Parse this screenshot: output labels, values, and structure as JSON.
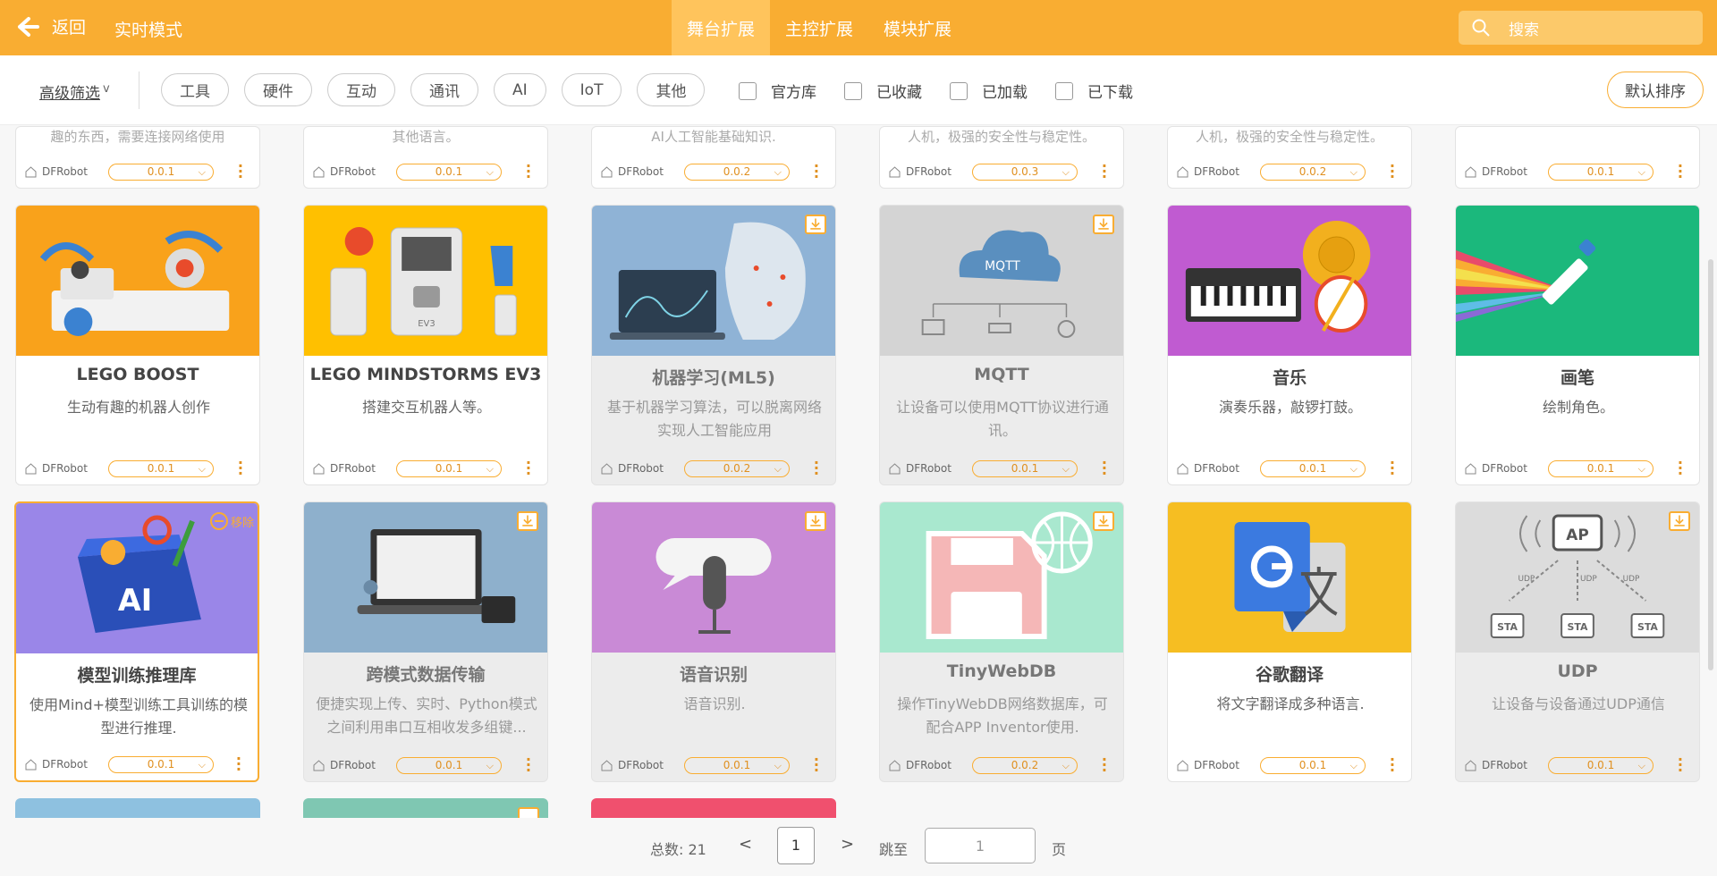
{
  "topbar": {
    "back_label": "返回",
    "realtime_label": "实时模式",
    "tabs": [
      "舞台扩展",
      "主控扩展",
      "模块扩展"
    ],
    "active_tab": 0,
    "search_placeholder": "搜索"
  },
  "filters": {
    "advanced_label": "高级筛选",
    "advanced_caret": "v",
    "chips": [
      "工具",
      "硬件",
      "互动",
      "通讯",
      "AI",
      "IoT",
      "其他"
    ],
    "checkboxes": [
      "官方库",
      "已收藏",
      "已加载",
      "已下载"
    ],
    "sort_label": "默认排序"
  },
  "top_partial_row": [
    {
      "desc": "趣的东西，需要连接网络使用",
      "author": "DFRobot",
      "version": "0.0.1"
    },
    {
      "desc": "其他语言。",
      "author": "DFRobot",
      "version": "0.0.1"
    },
    {
      "desc": "AI人工智能基础知识.",
      "author": "DFRobot",
      "version": "0.0.2"
    },
    {
      "desc": "人机，极强的安全性与稳定性。",
      "author": "DFRobot",
      "version": "0.0.3"
    },
    {
      "desc": "人机，极强的安全性与稳定性。",
      "author": "DFRobot",
      "version": "0.0.2"
    },
    {
      "desc": "",
      "author": "DFRobot",
      "version": "0.0.1"
    }
  ],
  "cards_row1": [
    {
      "title": "LEGO BOOST",
      "desc": "生动有趣的机器人创作",
      "author": "DFRobot",
      "version": "0.0.1",
      "image": "lego-boost-robot"
    },
    {
      "title": "LEGO MINDSTORMS EV3",
      "desc": "搭建交互机器人等。",
      "author": "DFRobot",
      "version": "0.0.1",
      "image": "lego-ev3-brick"
    },
    {
      "title": "机器学习(ML5)",
      "desc": "基于机器学习算法，可以脱离网络实现人工智能应用",
      "author": "DFRobot",
      "version": "0.0.2",
      "image": "ml5-face-laptop"
    },
    {
      "title": "MQTT",
      "desc": "让设备可以使用MQTT协议进行通讯。",
      "author": "DFRobot",
      "version": "0.0.1",
      "image": "mqtt-cloud"
    },
    {
      "title": "音乐",
      "desc": "演奏乐器，敲锣打鼓。",
      "author": "DFRobot",
      "version": "0.0.1",
      "image": "music-keyboard-drum"
    },
    {
      "title": "画笔",
      "desc": "绘制角色。",
      "author": "DFRobot",
      "version": "0.0.1",
      "image": "pen-rainbow"
    }
  ],
  "cards_row2": [
    {
      "title": "模型训练推理库",
      "desc": "使用Mind+模型训练工具训练的模型进行推理.",
      "author": "DFRobot",
      "version": "0.0.1",
      "image": "ai-toolbox",
      "remove_label": "移除"
    },
    {
      "title": "跨模式数据传输",
      "desc": "便捷实现上传、实时、Python模式之间利用串口互相收发多组键...",
      "author": "DFRobot",
      "version": "0.0.1",
      "image": "laptop-microbit"
    },
    {
      "title": "语音识别",
      "desc": "语音识别.",
      "author": "DFRobot",
      "version": "0.0.1",
      "image": "microphone-bubble"
    },
    {
      "title": "TinyWebDB",
      "desc": "操作TinyWebDB网络数据库，可配合APP Inventor使用.",
      "author": "DFRobot",
      "version": "0.0.2",
      "image": "floppy-globe"
    },
    {
      "title": "谷歌翻译",
      "desc": "将文字翻译成多种语言.",
      "author": "DFRobot",
      "version": "0.0.1",
      "image": "google-translate"
    },
    {
      "title": "UDP",
      "desc": "让设备与设备通过UDP通信",
      "author": "DFRobot",
      "version": "0.0.1",
      "image": "udp-ap-sta",
      "udp_labels": {
        "ap": "AP",
        "sta": "STA",
        "udp": "UDP"
      }
    }
  ],
  "mqtt_label": "MQTT",
  "ev3_label": "EV3",
  "ai_label": "AI",
  "pager": {
    "total_label": "总数: 21",
    "prev": "<",
    "current_page": "1",
    "next": ">",
    "jump_label": "跳至",
    "jump_value": "1",
    "page_suffix": "页"
  },
  "colors": {
    "accent": "#f9ad32",
    "accent_light": "#ffc45c"
  }
}
